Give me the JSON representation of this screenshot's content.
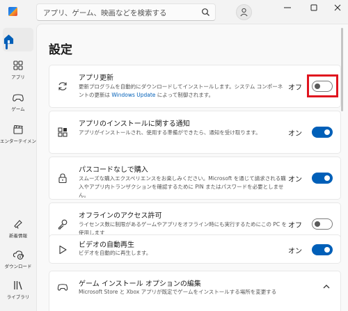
{
  "search": {
    "placeholder": "アプリ、ゲーム、映画などを検索する"
  },
  "sidebar": {
    "items": [
      {
        "label": "ホーム"
      },
      {
        "label": "アプリ"
      },
      {
        "label": "ゲーム"
      },
      {
        "label": "エンターテイメント"
      },
      {
        "label": "新着情報"
      },
      {
        "label": "ダウンロード"
      },
      {
        "label": "ライブラリ"
      }
    ]
  },
  "page": {
    "title": "設定"
  },
  "settings": [
    {
      "title": "アプリ更新",
      "desc_part1": "更新プログラムを自動的にダウンロードしてインストールします。システム コンポーネントの更新は ",
      "desc_link": "Windows Update",
      "desc_part2": " によって制御されます。",
      "state": "オフ",
      "on": false
    },
    {
      "title": "アプリのインストールに関する通知",
      "desc": "アプリがインストールされ、使用する準備ができたら、通知を受け取ります。",
      "state": "オン",
      "on": true
    },
    {
      "title": "パスコードなしで購入",
      "desc": "スムーズな購入エクスペリエンスをお楽しみください。Microsoft を通じて請求される購入やアプリ内トランザクションを確認するために PIN またはパスワードを必要としません。",
      "state": "オン",
      "on": true
    },
    {
      "title": "オフラインのアクセス許可",
      "desc": "ライセンス数に制限があるゲームやアプリをオフライン時にも実行するためにこの PC を使用します",
      "state": "オフ",
      "on": false
    },
    {
      "title": "ビデオの自動再生",
      "desc": "ビデオを自動的に再生します。",
      "state": "オン",
      "on": true
    },
    {
      "title": "ゲーム インストール オプションの編集",
      "desc": "Microsoft Store と Xbox アプリが既定でゲームをインストールする場所を変更する"
    }
  ],
  "colors": {
    "accent": "#005fb8",
    "highlight": "#e0141e"
  }
}
